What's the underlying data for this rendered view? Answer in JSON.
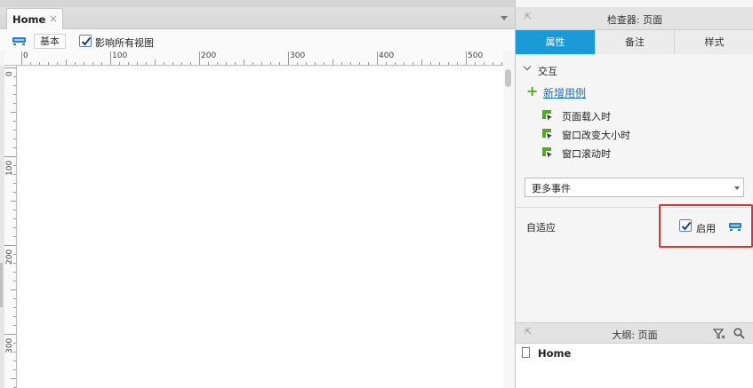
{
  "editor": {
    "tab_label": "Home",
    "tab_close": "×",
    "view_button": "基本",
    "affect_all_views": {
      "label": "影响所有视图",
      "checked": true
    },
    "ruler_h_labels": [
      "0",
      "100",
      "200",
      "300",
      "400",
      "500"
    ],
    "ruler_v_labels": [
      "0",
      "100",
      "200",
      "300"
    ]
  },
  "inspector": {
    "title": "检查器: 页面",
    "tabs": [
      {
        "label": "属性",
        "active": true
      },
      {
        "label": "备注",
        "active": false
      },
      {
        "label": "样式",
        "active": false
      }
    ],
    "interaction": {
      "section_title": "交互",
      "add_case": "新增用例",
      "events": [
        "页面载入时",
        "窗口改变大小时",
        "窗口滚动时"
      ]
    },
    "more_events": "更多事件",
    "adaptive": {
      "label": "自适应",
      "enable_label": "启用",
      "enabled": true
    },
    "accent_color": "#1a9ad6",
    "highlight_color": "#d9352b"
  },
  "outline": {
    "title": "大纲: 页面",
    "items": [
      "Home"
    ]
  }
}
